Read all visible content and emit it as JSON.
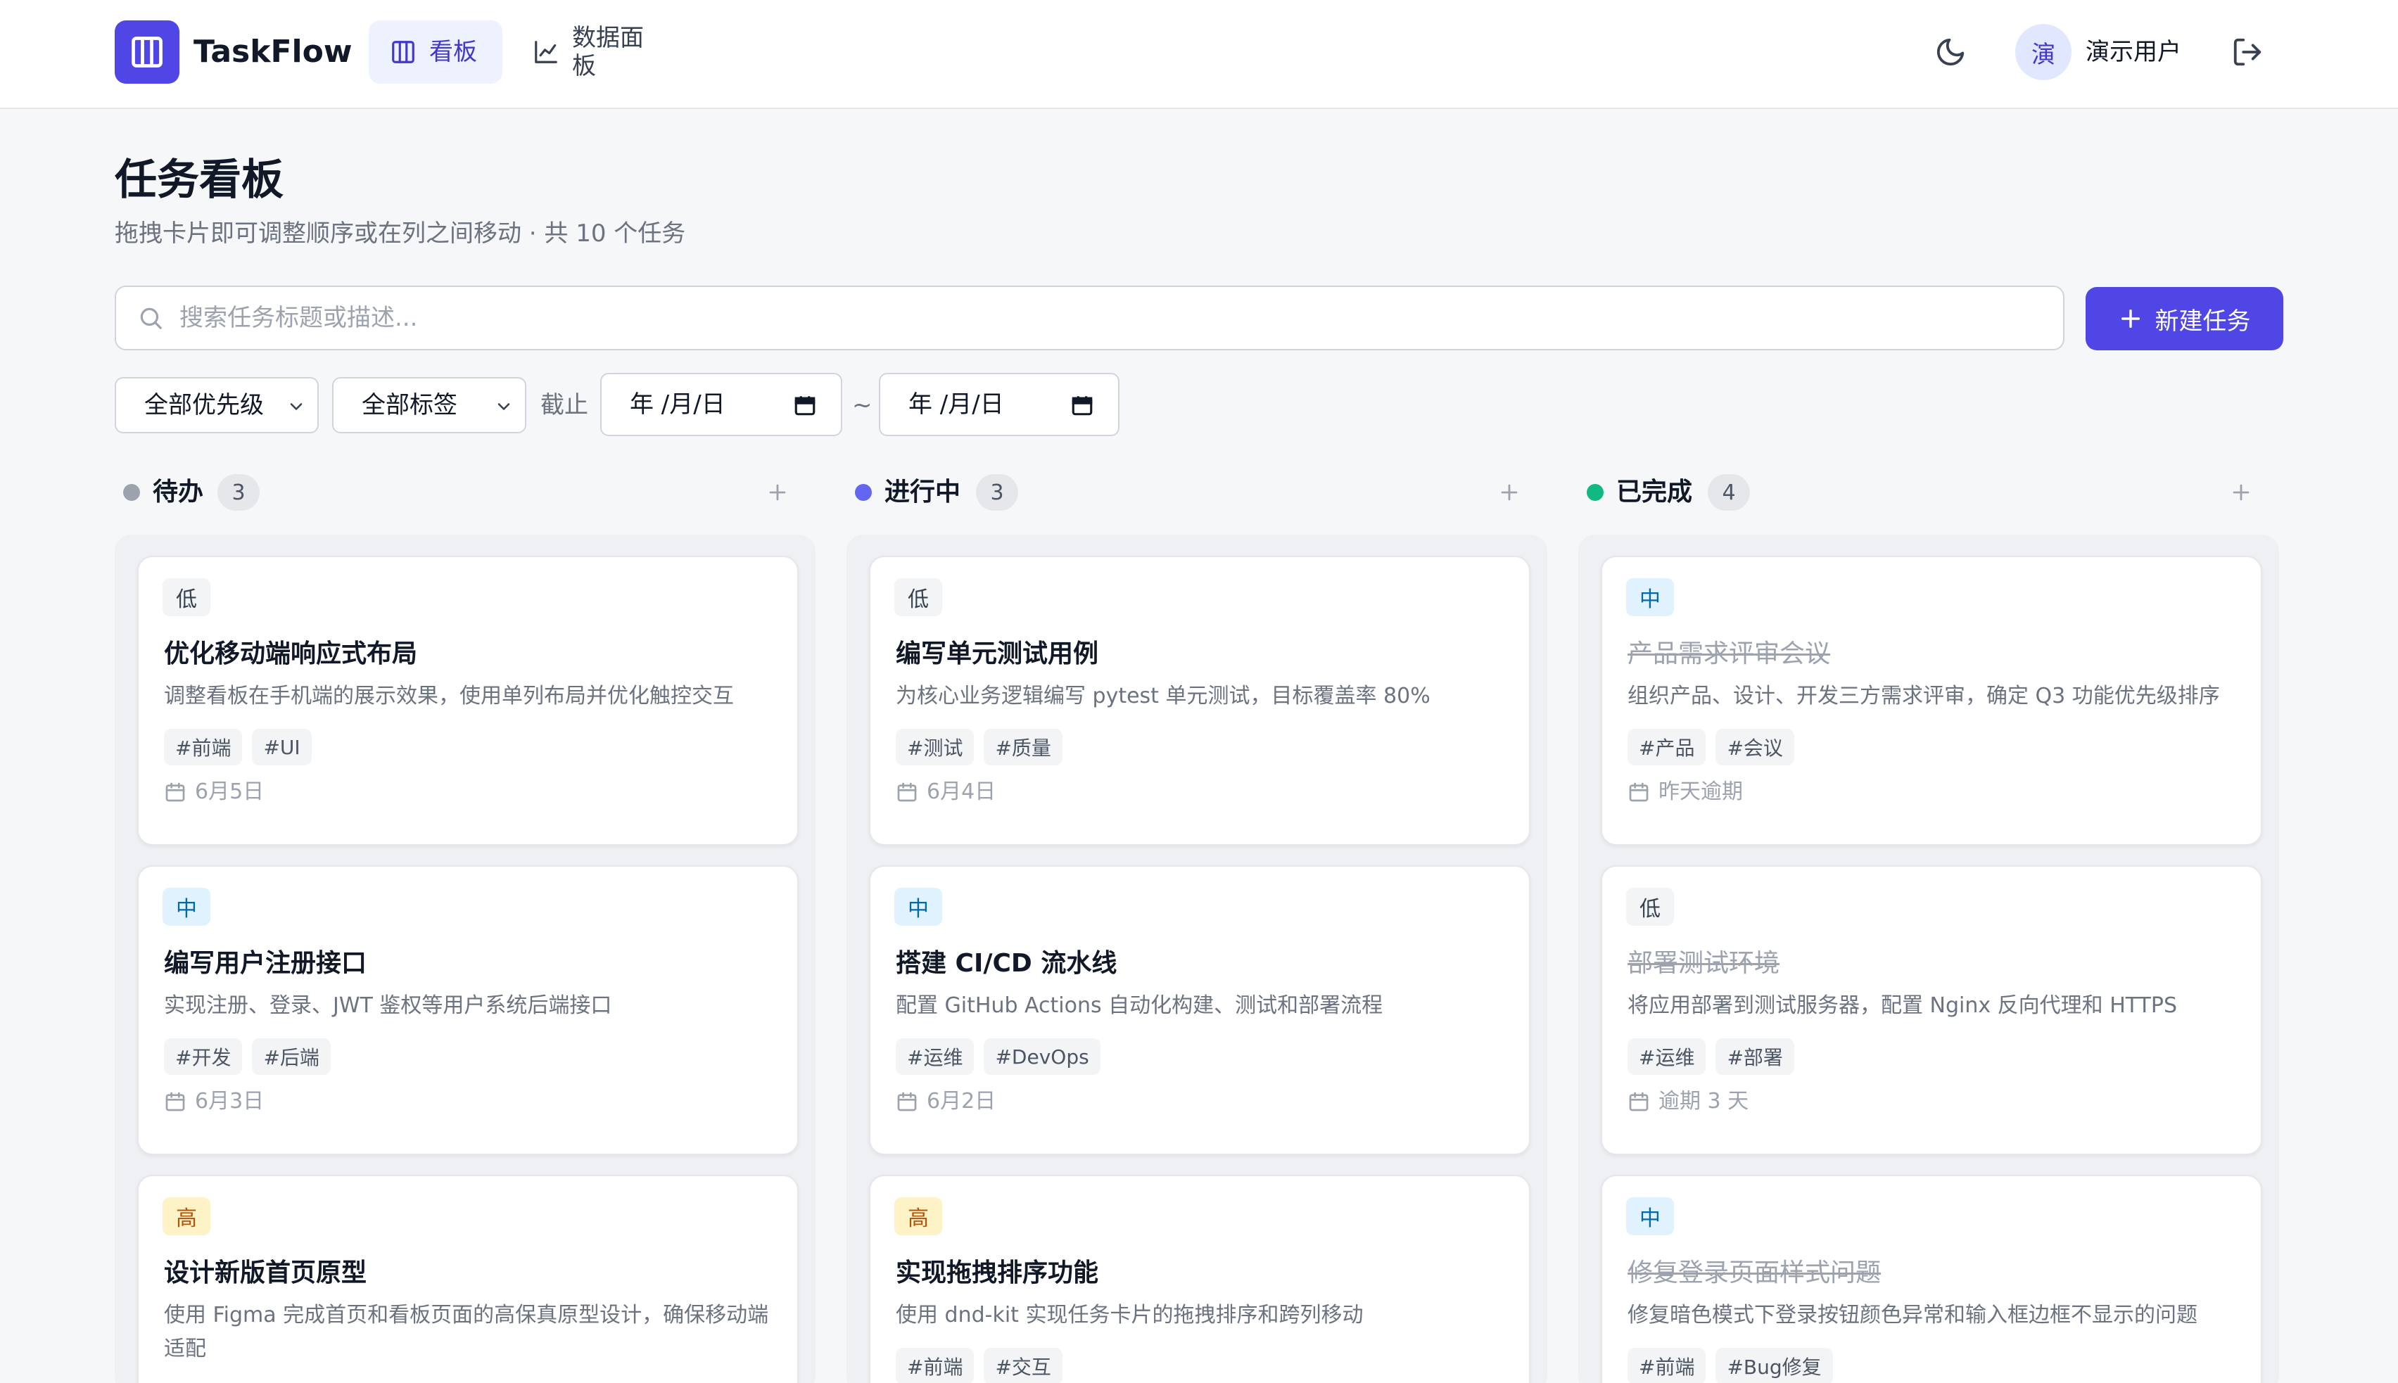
{
  "header": {
    "brand": "TaskFlow",
    "nav": [
      {
        "label": "看板"
      },
      {
        "label": "数据面板"
      }
    ],
    "avatar_initial": "演",
    "user_name": "演示用户"
  },
  "page": {
    "title": "任务看板",
    "subtitle": "拖拽卡片即可调整顺序或在列之间移动 · 共 10 个任务"
  },
  "search": {
    "placeholder": "搜索任务标题或描述...",
    "value": ""
  },
  "new_task_label": "新建任务",
  "filters": {
    "priority": "全部优先级",
    "tag": "全部标签",
    "deadline_label": "截止",
    "date_from": "年 /月/日",
    "date_to": "年 /月/日",
    "separator": "~"
  },
  "colors": {
    "accent": "#4f46e5",
    "todo_dot": "#9ca3af",
    "doing_dot": "#6366f1",
    "done_dot": "#10b981"
  },
  "columns": [
    {
      "title": "待办",
      "count": "3",
      "cards": [
        {
          "priority": "低",
          "title": "优化移动端响应式布局",
          "desc": "调整看板在手机端的展示效果，使用单列布局并优化触控交互",
          "tags": [
            "#前端",
            "#UI"
          ],
          "due": "6月5日"
        },
        {
          "priority": "中",
          "title": "编写用户注册接口",
          "desc": "实现注册、登录、JWT 鉴权等用户系统后端接口",
          "tags": [
            "#开发",
            "#后端"
          ],
          "due": "6月3日"
        },
        {
          "priority": "高",
          "title": "设计新版首页原型",
          "desc": "使用 Figma 完成首页和看板页面的高保真原型设计，确保移动端适配",
          "tags": [],
          "due": ""
        }
      ]
    },
    {
      "title": "进行中",
      "count": "3",
      "cards": [
        {
          "priority": "低",
          "title": "编写单元测试用例",
          "desc": "为核心业务逻辑编写 pytest 单元测试，目标覆盖率 80%",
          "tags": [
            "#测试",
            "#质量"
          ],
          "due": "6月4日"
        },
        {
          "priority": "中",
          "title": "搭建 CI/CD 流水线",
          "desc": "配置 GitHub Actions 自动化构建、测试和部署流程",
          "tags": [
            "#运维",
            "#DevOps"
          ],
          "due": "6月2日"
        },
        {
          "priority": "高",
          "title": "实现拖拽排序功能",
          "desc": "使用 dnd-kit 实现任务卡片的拖拽排序和跨列移动",
          "tags": [
            "#前端",
            "#交互"
          ],
          "due": ""
        }
      ]
    },
    {
      "title": "已完成",
      "count": "4",
      "cards": [
        {
          "priority": "中",
          "title": "产品需求评审会议",
          "desc": "组织产品、设计、开发三方需求评审，确定 Q3 功能优先级排序",
          "tags": [
            "#产品",
            "#会议"
          ],
          "due": "昨天逾期"
        },
        {
          "priority": "低",
          "title": "部署测试环境",
          "desc": "将应用部署到测试服务器，配置 Nginx 反向代理和 HTTPS",
          "tags": [
            "#运维",
            "#部署"
          ],
          "due": "逾期 3 天"
        },
        {
          "priority": "中",
          "title": "修复登录页面样式问题",
          "desc": "修复暗色模式下登录按钮颜色异常和输入框边框不显示的问题",
          "tags": [
            "#前端",
            "#Bug修复"
          ],
          "due": ""
        }
      ]
    }
  ]
}
